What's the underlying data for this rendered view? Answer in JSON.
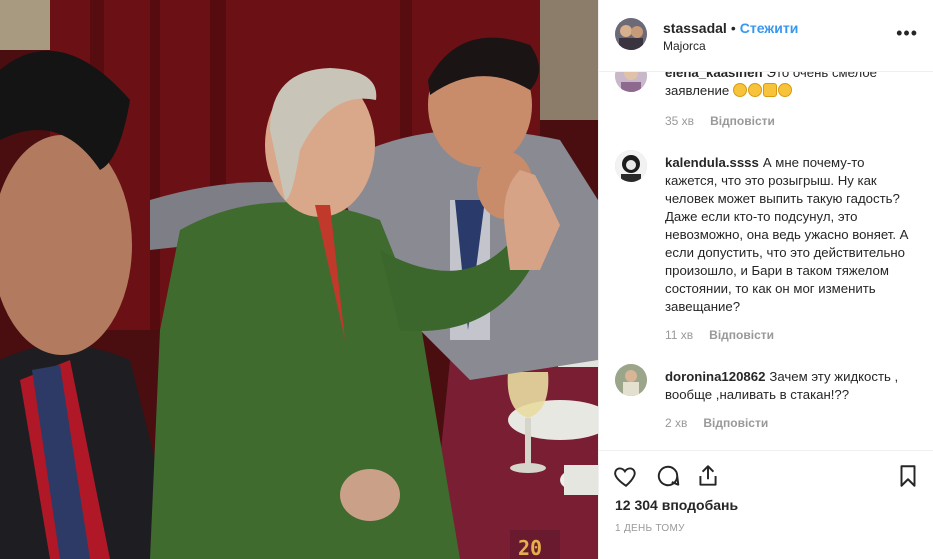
{
  "header": {
    "username": "stassadal",
    "separator": "•",
    "follow_label": "Стежити",
    "location": "Majorca",
    "more_label": "•••"
  },
  "comments": [
    {
      "username": "elena_kaasinen",
      "text": "Это очень смелое заявление",
      "emojis": [
        "pensive-face",
        "smirk-face",
        "victory-hand",
        "smile-face"
      ],
      "time": "35 хв",
      "reply_label": "Відповісти"
    },
    {
      "username": "kalendula.ssss",
      "text": "А мне почему-то кажется, что это розыгрыш. Ну как человек может выпить такую гадость? Даже если кто-то подсунул, это невозможно, она ведь ужасно воняет. А если допустить, что это действительно произошло, и Бари в таком тяжелом состоянии, то как он мог изменить завещание?",
      "time": "11 хв",
      "reply_label": "Відповісти"
    },
    {
      "username": "doronina120862",
      "text": "Зачем эту жидкость , вообще ,наливать в стакан!??",
      "time": "2 хв",
      "reply_label": "Відповісти"
    }
  ],
  "actions": {
    "icons": [
      "heart-icon",
      "comment-icon",
      "share-icon",
      "bookmark-icon"
    ],
    "likes": "12 304 вподобань",
    "posted": "1 ДЕНЬ ТОМУ"
  },
  "photo": {
    "number_on_photo": "20"
  },
  "colors": {
    "follow": "#3897f0",
    "text": "#262626",
    "muted": "#999999",
    "border": "#efefef"
  }
}
